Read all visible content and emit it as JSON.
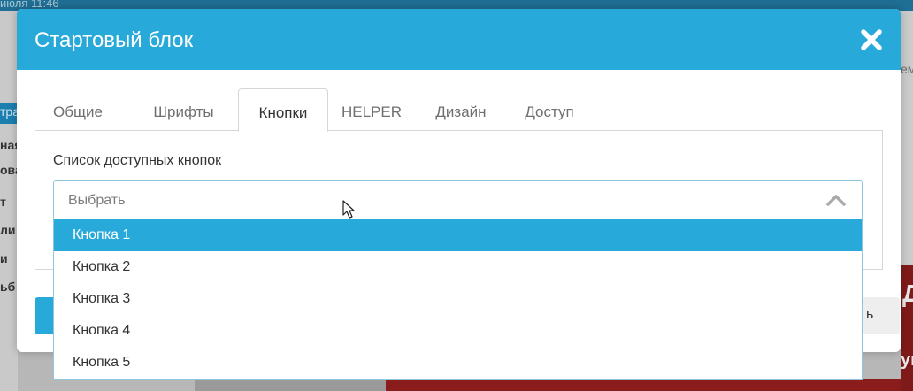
{
  "background": {
    "top_bar_text": "июля 11:46",
    "left_bar_text": "тра",
    "left_items": [
      "ная",
      "ова",
      "т",
      "ли",
      "и",
      "ьб"
    ],
    "right_text": "ем",
    "right_red_text_1": "Д",
    "right_red_text_2": "ущ"
  },
  "modal": {
    "title": "Стартовый блок",
    "tabs": [
      {
        "label": "Общие",
        "active": false
      },
      {
        "label": "Шрифты",
        "active": false
      },
      {
        "label": "Кнопки",
        "active": true
      },
      {
        "label": "HELPER",
        "active": false
      },
      {
        "label": "Дизайн",
        "active": false
      },
      {
        "label": "Доступ",
        "active": false
      }
    ],
    "field_label": "Список доступных кнопок",
    "select": {
      "placeholder": "Выбрать",
      "options": [
        "Кнопка 1",
        "Кнопка 2",
        "Кнопка 3",
        "Кнопка 4",
        "Кнопка 5"
      ],
      "highlighted": "Кнопка 1"
    },
    "footer_right_partial": "ь"
  },
  "colors": {
    "accent": "#27a9da",
    "tab_border": "#d6d6d6",
    "select_border": "#8fc6de"
  },
  "icons": {
    "close": "close-icon",
    "chevron": "chevron-up-icon",
    "cursor": "mouse-cursor-icon"
  }
}
